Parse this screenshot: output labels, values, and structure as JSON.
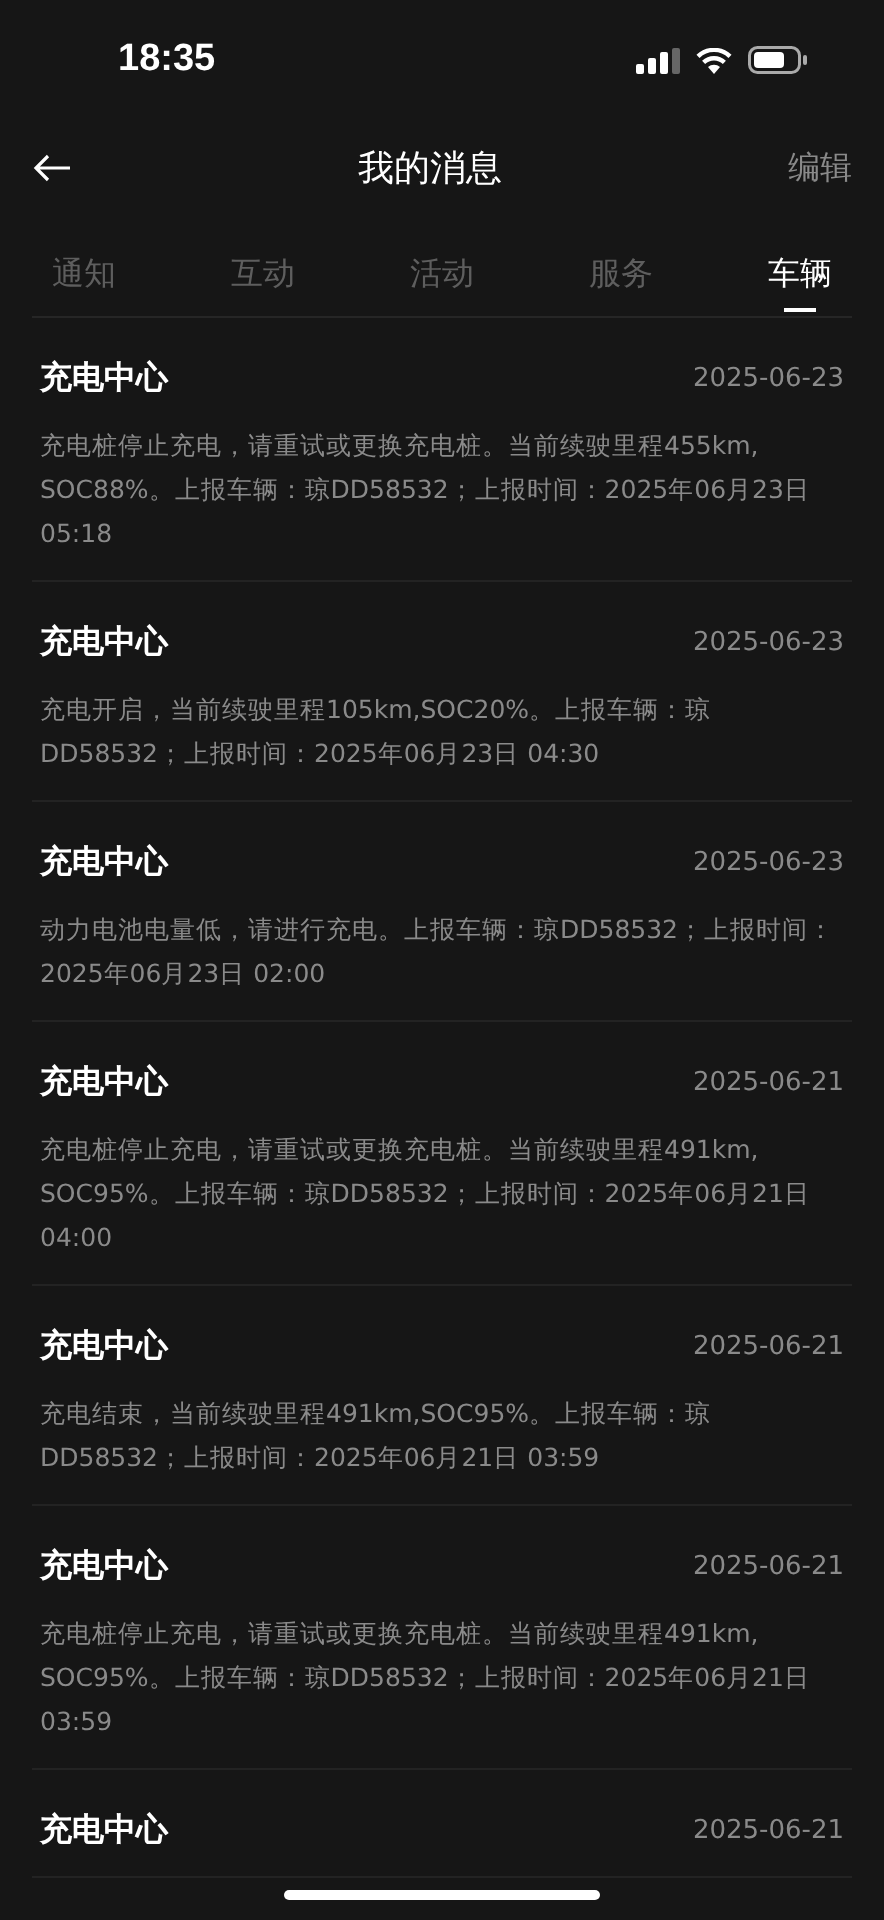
{
  "status_bar": {
    "time": "18:35"
  },
  "nav": {
    "title": "我的消息",
    "action": "编辑"
  },
  "tabs": [
    {
      "label": "通知",
      "selected": false
    },
    {
      "label": "互动",
      "selected": false
    },
    {
      "label": "活动",
      "selected": false
    },
    {
      "label": "服务",
      "selected": false
    },
    {
      "label": "车辆",
      "selected": true
    }
  ],
  "messages": [
    {
      "title": "充电中心",
      "date": "2025-06-23",
      "body": "充电桩停止充电，请重试或更换充电桩。当前续驶里程455km, SOC88%。上报车辆：琼DD58532；上报时间：2025年06月23日 05:18"
    },
    {
      "title": "充电中心",
      "date": "2025-06-23",
      "body": "充电开启，当前续驶里程105km,SOC20%。上报车辆：琼 DD58532；上报时间：2025年06月23日 04:30"
    },
    {
      "title": "充电中心",
      "date": "2025-06-23",
      "body": "动力电池电量低，请进行充电。上报车辆：琼DD58532；上报时间：2025年06月23日 02:00"
    },
    {
      "title": "充电中心",
      "date": "2025-06-21",
      "body": "充电桩停止充电，请重试或更换充电桩。当前续驶里程491km, SOC95%。上报车辆：琼DD58532；上报时间：2025年06月21日 04:00"
    },
    {
      "title": "充电中心",
      "date": "2025-06-21",
      "body": "充电结束，当前续驶里程491km,SOC95%。上报车辆：琼 DD58532；上报时间：2025年06月21日 03:59"
    },
    {
      "title": "充电中心",
      "date": "2025-06-21",
      "body": "充电桩停止充电，请重试或更换充电桩。当前续驶里程491km, SOC95%。上报车辆：琼DD58532；上报时间：2025年06月21日 03:59"
    },
    {
      "title": "充电中心",
      "date": "2025-06-21"
    }
  ]
}
